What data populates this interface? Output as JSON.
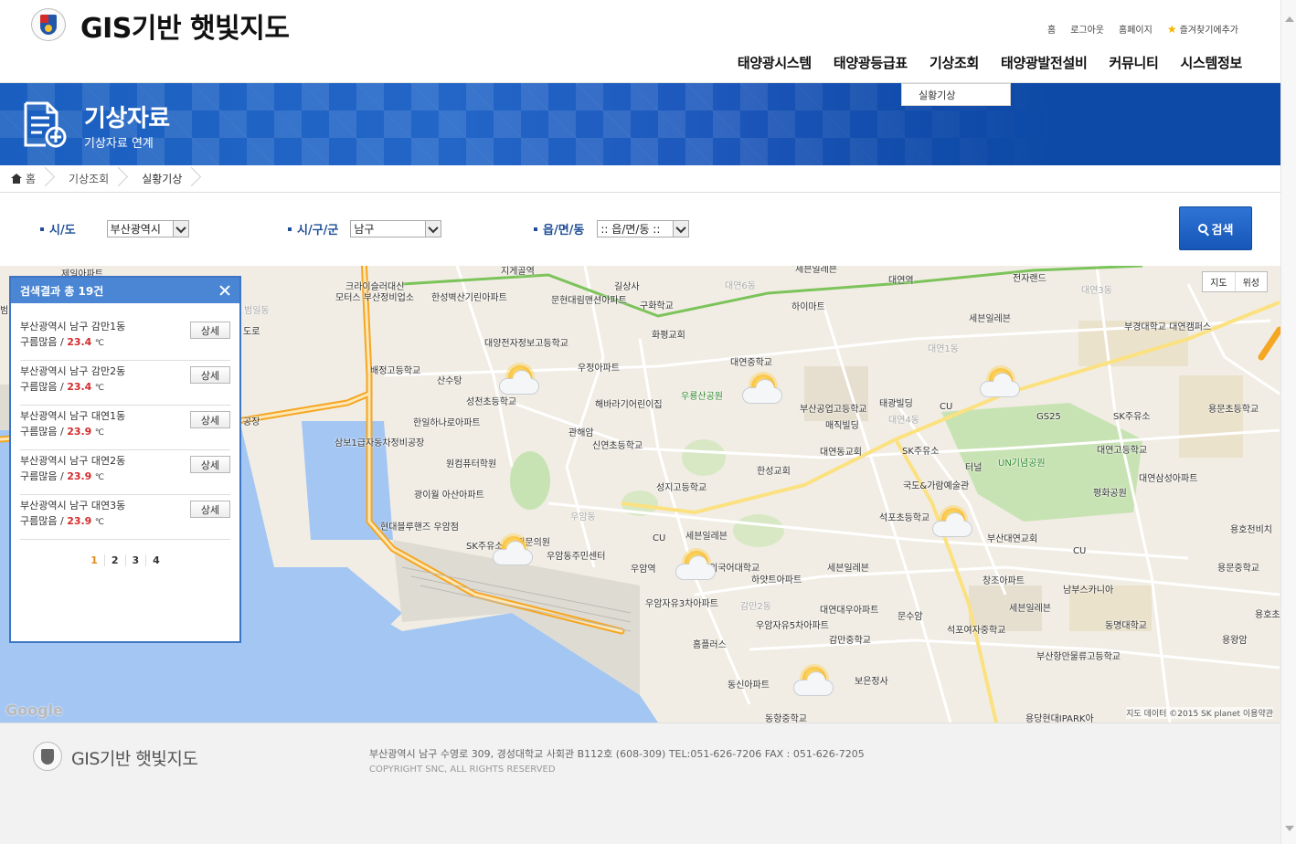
{
  "header": {
    "site_title": "GIS기반 햇빛지도",
    "util_links": [
      "홈",
      "로그아웃",
      "홈페이지",
      "즐겨찾기에추가"
    ],
    "gnb": [
      "태양광시스템",
      "태양광등급표",
      "기상조회",
      "태양광발전설비",
      "커뮤니티",
      "시스템정보"
    ],
    "submenu": [
      "실황기상"
    ]
  },
  "banner": {
    "title": "기상자료",
    "subtitle": "기상자료 연계"
  },
  "breadcrumb": [
    "홈",
    "기상조회",
    "실황기상"
  ],
  "search": {
    "sido_label": "시/도",
    "sido_value": "부산광역시",
    "sigungu_label": "시/구/군",
    "sigungu_value": "남구",
    "eupmyeondong_label": "읍/면/동",
    "eupmyeondong_value": ":: 읍/면/동 ::",
    "search_button": "검색"
  },
  "map": {
    "type_buttons": [
      "지도",
      "위성"
    ],
    "google": "Google",
    "copyright": "지도 데이터 ©2015 SK planet   이용약관",
    "labels": [
      "제일아파트",
      "범일동",
      "크라이슬러대신",
      "모터스 부산정비업소",
      "한성벽산기린아파트",
      "지게골역",
      "길상사",
      "문현대림맨션아파트",
      "구화학교",
      "세븐일레븐",
      "대연역",
      "전자랜드",
      "하이마트",
      "대연6동",
      "대연3동",
      "세븐일레븐",
      "부경대학교 대연캠퍼스",
      "배정고등학교",
      "산수탕",
      "대양전자정보고등학교",
      "화평교회",
      "우정아파트",
      "대연1동",
      "대연중학교",
      "성천초등학교",
      "해바라기어린이집",
      "우룡산공원",
      "부산공업고등학교",
      "태광빌딩",
      "CU",
      "GS25",
      "SK주유소",
      "용문초등학교",
      "한일하나로아파트",
      "관해암",
      "신연초등학교",
      "매직빌딩",
      "대연4동",
      "대연동교회",
      "SK주유소",
      "터널",
      "UN기념공원",
      "대연고등학교",
      "삼보1급자동차정비공장",
      "원컴퓨터학원",
      "한성교회",
      "국도&가람예술관",
      "대연삼성아파트",
      "광이월 아산아파트",
      "성지고등학교",
      "평화공원",
      "우암동",
      "석포초등학교",
      "부산대연교회",
      "현대블루핸즈 우암점",
      "세븐일레븐",
      "SK주유소",
      "대진문의원",
      "CU",
      "우암동주민센터",
      "우암역",
      "외국어대학교",
      "하얏트아파트",
      "세븐일레븐",
      "창조아파트",
      "CU",
      "남부스카니아",
      "용호천비치",
      "우암자유3차아파트",
      "감만2동",
      "대연대우아파트",
      "문수암",
      "세븐일레븐",
      "용문중학교",
      "홈플러스",
      "우암자유5차아파트",
      "석포여자중학교",
      "동명대학교",
      "감만중학교",
      "용호초",
      "용왕암",
      "동신아파트",
      "보은정사",
      "부산항만물류고등학교",
      "동항중학교",
      "용당현대IPARK아",
      "범일동",
      "도로",
      "공장"
    ]
  },
  "result_panel": {
    "title": "검색결과 총 19건",
    "detail_label": "상세",
    "unit": "℃",
    "items": [
      {
        "address": "부산광역시 남구 감만1동",
        "condition": "구름많음",
        "temp": "23.4"
      },
      {
        "address": "부산광역시 남구 감만2동",
        "condition": "구름많음",
        "temp": "23.4"
      },
      {
        "address": "부산광역시 남구 대연1동",
        "condition": "구름많음",
        "temp": "23.9"
      },
      {
        "address": "부산광역시 남구 대연2동",
        "condition": "구름많음",
        "temp": "23.9"
      },
      {
        "address": "부산광역시 남구 대연3동",
        "condition": "구름많음",
        "temp": "23.9"
      }
    ],
    "pages": [
      "1",
      "2",
      "3",
      "4"
    ],
    "current_page": "1"
  },
  "footer": {
    "title": "GIS기반 햇빛지도",
    "address": "부산광역시 남구 수영로 309, 경성대학교 사회관 B112호 (608-309) TEL:051-626-7206 FAX : 051-626-7205",
    "copyright": "COPYRIGHT SNC, ALL RIGHTS RESERVED"
  },
  "colors": {
    "primary": "#1f4e96",
    "banner": "#1a5fbf",
    "temp": "#d42b2b",
    "panel_head": "#4a86d4"
  }
}
